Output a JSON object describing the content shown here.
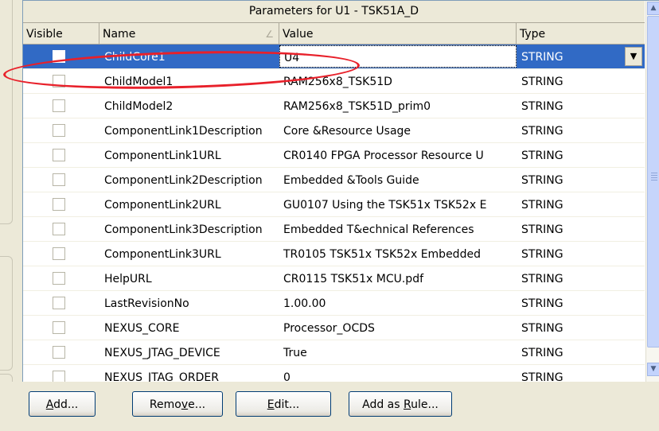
{
  "grid": {
    "caption": "Parameters for U1 - TSK51A_D",
    "columns": {
      "visible": "Visible",
      "name": "Name",
      "value": "Value",
      "type": "Type"
    },
    "rows": [
      {
        "name": "ChildCore1",
        "value": "U4",
        "type": "STRING",
        "visible": false,
        "selected": true
      },
      {
        "name": "ChildModel1",
        "value": "RAM256x8_TSK51D",
        "type": "STRING",
        "visible": false
      },
      {
        "name": "ChildModel2",
        "value": "RAM256x8_TSK51D_prim0",
        "type": "STRING",
        "visible": false
      },
      {
        "name": "ComponentLink1Description",
        "value": "Core &Resource Usage",
        "type": "STRING",
        "visible": false
      },
      {
        "name": "ComponentLink1URL",
        "value": "CR0140 FPGA Processor Resource U",
        "type": "STRING",
        "visible": false
      },
      {
        "name": "ComponentLink2Description",
        "value": "Embedded &Tools Guide",
        "type": "STRING",
        "visible": false
      },
      {
        "name": "ComponentLink2URL",
        "value": "GU0107 Using the TSK51x TSK52x E",
        "type": "STRING",
        "visible": false
      },
      {
        "name": "ComponentLink3Description",
        "value": "Embedded T&echnical References",
        "type": "STRING",
        "visible": false
      },
      {
        "name": "ComponentLink3URL",
        "value": "TR0105 TSK51x TSK52x Embedded ",
        "type": "STRING",
        "visible": false
      },
      {
        "name": "HelpURL",
        "value": "CR0115 TSK51x MCU.pdf",
        "type": "STRING",
        "visible": false
      },
      {
        "name": "LastRevisionNo",
        "value": "1.00.00",
        "type": "STRING",
        "visible": false
      },
      {
        "name": "NEXUS_CORE",
        "value": "Processor_OCDS",
        "type": "STRING",
        "visible": false
      },
      {
        "name": "NEXUS_JTAG_DEVICE",
        "value": "True",
        "type": "STRING",
        "visible": false
      },
      {
        "name": "NEXUS_JTAG_ORDER",
        "value": "0",
        "type": "STRING",
        "visible": false
      }
    ]
  },
  "buttons": {
    "add": {
      "pre": "",
      "key": "A",
      "post": "dd..."
    },
    "remove": {
      "pre": "Remo",
      "key": "v",
      "post": "e..."
    },
    "edit": {
      "pre": "",
      "key": "E",
      "post": "dit..."
    },
    "add_as_rule": {
      "pre": "Add as ",
      "key": "R",
      "post": "ule..."
    }
  },
  "colors": {
    "selection": "#316ac5",
    "annotation": "#e8202a"
  },
  "icons": {
    "sort": "sort-ascending-icon",
    "dropdown": "chevron-down-icon",
    "scroll_up": "scroll-up-icon",
    "scroll_down": "scroll-down-icon"
  }
}
